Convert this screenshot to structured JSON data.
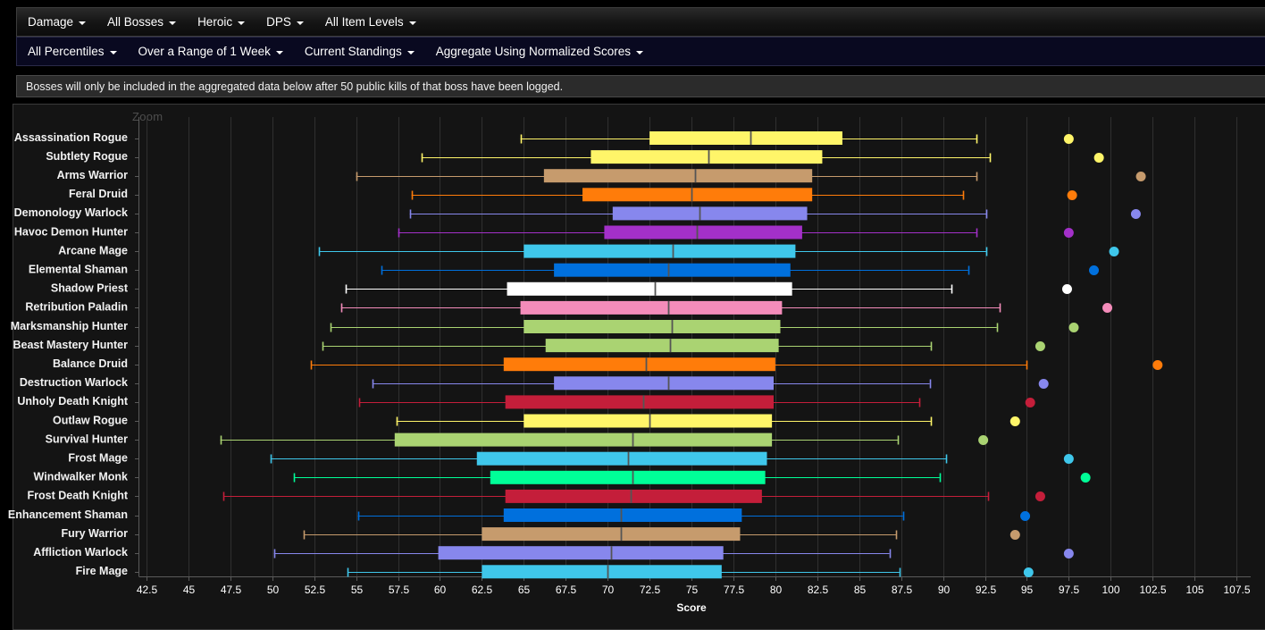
{
  "toolbar_primary": {
    "items": [
      {
        "label": "Damage",
        "name": "menu-damage"
      },
      {
        "label": "All Bosses",
        "name": "menu-all-bosses"
      },
      {
        "label": "Heroic",
        "name": "menu-heroic"
      },
      {
        "label": "DPS",
        "name": "menu-dps"
      },
      {
        "label": "All Item Levels",
        "name": "menu-all-item-levels"
      }
    ]
  },
  "toolbar_secondary": {
    "items": [
      {
        "label": "All Percentiles",
        "name": "menu-all-percentiles"
      },
      {
        "label": "Over a Range of 1 Week",
        "name": "menu-range-1-week"
      },
      {
        "label": "Current Standings",
        "name": "menu-current-standings"
      },
      {
        "label": "Aggregate Using Normalized Scores",
        "name": "menu-aggregate-normalized"
      }
    ]
  },
  "notice": {
    "text": "Bosses will only be included in the aggregated data below after 50 public kills of that boss have been logged."
  },
  "zoom_label": "Zoom",
  "chart_data": {
    "type": "boxplot",
    "title": "",
    "xlabel": "Score",
    "ylabel": "",
    "xlim": [
      41.5,
      108.6
    ],
    "grid": true,
    "legend": "none",
    "xticks": [
      42.5,
      45,
      47.5,
      50,
      52.5,
      55,
      57.5,
      60,
      62.5,
      65,
      67.5,
      70,
      72.5,
      75,
      77.5,
      80,
      82.5,
      85,
      87.5,
      90,
      92.5,
      95,
      97.5,
      100,
      102.5,
      105,
      107.5
    ],
    "categories": [
      "Assassination Rogue",
      "Subtlety Rogue",
      "Arms Warrior",
      "Feral Druid",
      "Demonology Warlock",
      "Havoc Demon Hunter",
      "Arcane Mage",
      "Elemental Shaman",
      "Shadow Priest",
      "Retribution Paladin",
      "Marksmanship Hunter",
      "Beast Mastery Hunter",
      "Balance Druid",
      "Destruction Warlock",
      "Unholy Death Knight",
      "Outlaw Rogue",
      "Survival Hunter",
      "Frost Mage",
      "Windwalker Monk",
      "Frost Death Knight",
      "Enhancement Shaman",
      "Fury Warrior",
      "Affliction Warlock",
      "Fire Mage"
    ],
    "boxes": [
      {
        "category": "Assassination Rogue",
        "color": "#FFF569",
        "whisker_low": 64.8,
        "q1": 72.5,
        "median": 78.5,
        "q3": 84.0,
        "whisker_high": 92.0,
        "outlier": 97.5
      },
      {
        "category": "Subtlety Rogue",
        "color": "#FFF569",
        "whisker_low": 58.9,
        "q1": 69.0,
        "median": 76.0,
        "q3": 82.8,
        "whisker_high": 92.8,
        "outlier": 99.3
      },
      {
        "category": "Arms Warrior",
        "color": "#C69B6D",
        "whisker_low": 55.0,
        "q1": 66.2,
        "median": 75.2,
        "q3": 82.2,
        "whisker_high": 92.0,
        "outlier": 101.8
      },
      {
        "category": "Feral Druid",
        "color": "#FF7C0A",
        "whisker_low": 58.3,
        "q1": 68.5,
        "median": 75.0,
        "q3": 82.2,
        "whisker_high": 91.2,
        "outlier": 97.7
      },
      {
        "category": "Demonology Warlock",
        "color": "#8787ED",
        "whisker_low": 58.2,
        "q1": 70.3,
        "median": 75.5,
        "q3": 81.9,
        "whisker_high": 92.6,
        "outlier": 101.5
      },
      {
        "category": "Havoc Demon Hunter",
        "color": "#A330C9",
        "whisker_low": 57.5,
        "q1": 69.8,
        "median": 75.3,
        "q3": 81.6,
        "whisker_high": 92.0,
        "outlier": 97.5
      },
      {
        "category": "Arcane Mage",
        "color": "#3FC7EB",
        "whisker_low": 52.8,
        "q1": 65.0,
        "median": 73.9,
        "q3": 81.2,
        "whisker_high": 92.6,
        "outlier": 100.2
      },
      {
        "category": "Elemental Shaman",
        "color": "#0070DD",
        "whisker_low": 56.5,
        "q1": 66.8,
        "median": 73.6,
        "q3": 80.9,
        "whisker_high": 91.5,
        "outlier": 99.0
      },
      {
        "category": "Shadow Priest",
        "color": "#FFFFFF",
        "whisker_low": 54.4,
        "q1": 64.0,
        "median": 72.8,
        "q3": 81.0,
        "whisker_high": 90.5,
        "outlier": 97.4
      },
      {
        "category": "Retribution Paladin",
        "color": "#F48CBA",
        "whisker_low": 54.1,
        "q1": 64.8,
        "median": 73.6,
        "q3": 80.4,
        "whisker_high": 93.4,
        "outlier": 99.8
      },
      {
        "category": "Marksmanship Hunter",
        "color": "#AAD372",
        "whisker_low": 53.5,
        "q1": 65.0,
        "median": 73.8,
        "q3": 80.3,
        "whisker_high": 93.2,
        "outlier": 97.8
      },
      {
        "category": "Beast Mastery Hunter",
        "color": "#AAD372",
        "whisker_low": 53.0,
        "q1": 66.3,
        "median": 73.7,
        "q3": 80.2,
        "whisker_high": 89.3,
        "outlier": 95.8
      },
      {
        "category": "Balance Druid",
        "color": "#FF7C0A",
        "whisker_low": 52.3,
        "q1": 63.8,
        "median": 72.3,
        "q3": 80.0,
        "whisker_high": 95.0,
        "outlier": 102.8
      },
      {
        "category": "Destruction Warlock",
        "color": "#8787ED",
        "whisker_low": 56.0,
        "q1": 66.8,
        "median": 73.6,
        "q3": 79.9,
        "whisker_high": 89.2,
        "outlier": 96.0
      },
      {
        "category": "Unholy Death Knight",
        "color": "#C41E3A",
        "whisker_low": 55.2,
        "q1": 63.9,
        "median": 72.1,
        "q3": 79.9,
        "whisker_high": 88.6,
        "outlier": 95.2
      },
      {
        "category": "Outlaw Rogue",
        "color": "#FFF569",
        "whisker_low": 57.4,
        "q1": 65.0,
        "median": 72.5,
        "q3": 79.8,
        "whisker_high": 89.3,
        "outlier": 94.3
      },
      {
        "category": "Survival Hunter",
        "color": "#AAD372",
        "whisker_low": 46.9,
        "q1": 57.3,
        "median": 71.5,
        "q3": 79.8,
        "whisker_high": 87.3,
        "outlier": 92.4
      },
      {
        "category": "Frost Mage",
        "color": "#3FC7EB",
        "whisker_low": 49.9,
        "q1": 62.2,
        "median": 71.2,
        "q3": 79.5,
        "whisker_high": 90.2,
        "outlier": 97.5
      },
      {
        "category": "Windwalker Monk",
        "color": "#00FF98",
        "whisker_low": 51.3,
        "q1": 63.0,
        "median": 71.5,
        "q3": 79.4,
        "whisker_high": 89.8,
        "outlier": 98.5
      },
      {
        "category": "Frost Death Knight",
        "color": "#C41E3A",
        "whisker_low": 47.1,
        "q1": 63.9,
        "median": 71.4,
        "q3": 79.2,
        "whisker_high": 92.7,
        "outlier": 95.8
      },
      {
        "category": "Enhancement Shaman",
        "color": "#0070DD",
        "whisker_low": 55.1,
        "q1": 63.8,
        "median": 70.8,
        "q3": 78.0,
        "whisker_high": 87.6,
        "outlier": 94.9
      },
      {
        "category": "Fury Warrior",
        "color": "#C69B6D",
        "whisker_low": 51.9,
        "q1": 62.5,
        "median": 70.8,
        "q3": 77.9,
        "whisker_high": 87.2,
        "outlier": 94.3
      },
      {
        "category": "Affliction Warlock",
        "color": "#8787ED",
        "whisker_low": 50.1,
        "q1": 59.9,
        "median": 70.2,
        "q3": 76.9,
        "whisker_high": 86.8,
        "outlier": 97.5
      },
      {
        "category": "Fire Mage",
        "color": "#3FC7EB",
        "whisker_low": 54.5,
        "q1": 62.5,
        "median": 70.0,
        "q3": 76.8,
        "whisker_high": 87.4,
        "outlier": 95.1
      }
    ]
  }
}
